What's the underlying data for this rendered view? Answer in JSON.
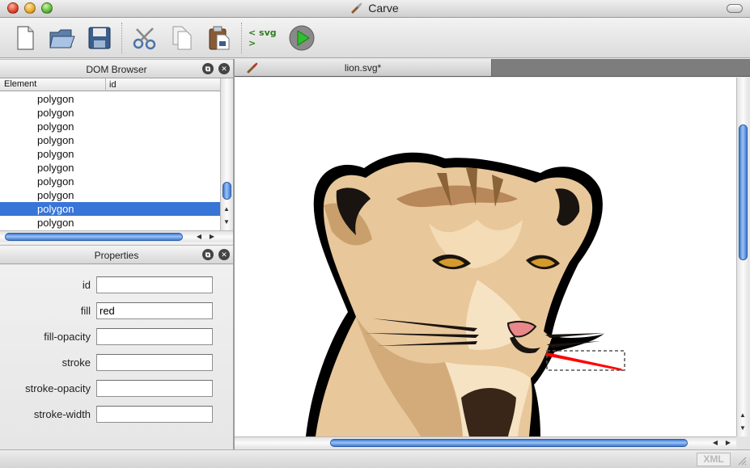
{
  "window": {
    "title": "Carve"
  },
  "toolbar": {
    "svg_label": "< svg >",
    "buttons": [
      "new-document-icon",
      "open-folder-icon",
      "save-disk-icon",
      "cut-scissors-icon",
      "copy-icon",
      "paste-icon",
      "svg-tag-icon",
      "run-play-icon"
    ]
  },
  "dom_browser": {
    "title": "DOM Browser",
    "columns": {
      "element": "Element",
      "id": "id"
    },
    "rows": [
      "polygon",
      "polygon",
      "polygon",
      "polygon",
      "polygon",
      "polygon",
      "polygon",
      "polygon",
      "polygon",
      "polygon"
    ],
    "selected_index": 8
  },
  "properties": {
    "title": "Properties",
    "fields": [
      {
        "label": "id",
        "value": ""
      },
      {
        "label": "fill",
        "value": "red"
      },
      {
        "label": "fill-opacity",
        "value": ""
      },
      {
        "label": "stroke",
        "value": ""
      },
      {
        "label": "stroke-opacity",
        "value": ""
      },
      {
        "label": "stroke-width",
        "value": ""
      }
    ]
  },
  "document": {
    "tab_label": "lion.svg*"
  },
  "status": {
    "xml_label": "XML"
  },
  "colors": {
    "selection": "#3875d7",
    "scroll_accent": "#5a94e6",
    "highlight_fill": "red"
  }
}
